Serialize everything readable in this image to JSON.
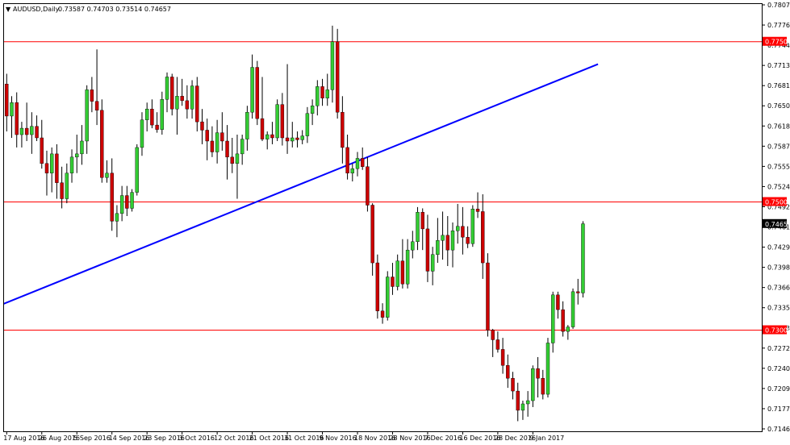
{
  "header": {
    "arrow": "▼",
    "symbol": "AUDUSD,Daily",
    "ohlc": "0.73587 0.74703 0.73514 0.74657"
  },
  "colors": {
    "background": "#ffffff",
    "frame": "#000000",
    "bull": "#33cc33",
    "bear": "#cc0000",
    "wick": "#000000",
    "hline": "#ff0000",
    "trendline": "#0000ff",
    "price_tag_bg": "#ff0000",
    "price_tag_text": "#ffffff",
    "current_tag_bg": "#000000",
    "current_tag_text": "#ffffff"
  },
  "chart_data": {
    "type": "candlestick",
    "symbol": "AUDUSD",
    "timeframe": "Daily",
    "ylim": [
      0.7146,
      0.78075
    ],
    "y_ticks": [
      "0.78075",
      "0.77760",
      "0.77445",
      "0.77130",
      "0.76815",
      "0.76500",
      "0.76185",
      "0.75870",
      "0.75555",
      "0.75240",
      "0.74925",
      "0.74610",
      "0.74295",
      "0.73980",
      "0.73665",
      "0.73350",
      "0.73035",
      "0.72720",
      "0.72405",
      "0.72090",
      "0.71775",
      "0.71460"
    ],
    "x_labels": [
      {
        "label": "17 Aug 2016",
        "index": 0
      },
      {
        "label": "26 Aug 2016",
        "index": 7
      },
      {
        "label": "5 Sep 2016",
        "index": 14
      },
      {
        "label": "14 Sep 2016",
        "index": 21
      },
      {
        "label": "23 Sep 2016",
        "index": 28
      },
      {
        "label": "3 Oct 2016",
        "index": 35
      },
      {
        "label": "12 Oct 2016",
        "index": 42
      },
      {
        "label": "21 Oct 2016",
        "index": 49
      },
      {
        "label": "31 Oct 2016",
        "index": 56
      },
      {
        "label": "9 Nov 2016",
        "index": 63
      },
      {
        "label": "18 Nov 2016",
        "index": 70
      },
      {
        "label": "28 Nov 2016",
        "index": 77
      },
      {
        "label": "7 Dec 2016",
        "index": 84
      },
      {
        "label": "16 Dec 2016",
        "index": 91
      },
      {
        "label": "28 Dec 2016",
        "index": 98
      },
      {
        "label": "9 Jan 2017",
        "index": 105
      }
    ],
    "candles": [
      [
        0.7684,
        0.77,
        0.761,
        0.7634
      ],
      [
        0.7634,
        0.7665,
        0.76,
        0.7655
      ],
      [
        0.7655,
        0.7671,
        0.7585,
        0.7605
      ],
      [
        0.7605,
        0.7625,
        0.7585,
        0.7615
      ],
      [
        0.7615,
        0.7655,
        0.7595,
        0.7605
      ],
      [
        0.7605,
        0.764,
        0.7575,
        0.7618
      ],
      [
        0.7618,
        0.7635,
        0.7595,
        0.76
      ],
      [
        0.76,
        0.7628,
        0.7552,
        0.756
      ],
      [
        0.756,
        0.758,
        0.751,
        0.7545
      ],
      [
        0.7545,
        0.7585,
        0.7515,
        0.7575
      ],
      [
        0.7575,
        0.759,
        0.7505,
        0.753
      ],
      [
        0.753,
        0.7555,
        0.749,
        0.7505
      ],
      [
        0.7505,
        0.756,
        0.7498,
        0.7545
      ],
      [
        0.7545,
        0.7582,
        0.753,
        0.757
      ],
      [
        0.757,
        0.7605,
        0.7545,
        0.7575
      ],
      [
        0.7575,
        0.762,
        0.7558,
        0.7595
      ],
      [
        0.7595,
        0.7682,
        0.7575,
        0.7675
      ],
      [
        0.7675,
        0.7695,
        0.764,
        0.7657
      ],
      [
        0.7657,
        0.7738,
        0.762,
        0.7643
      ],
      [
        0.7643,
        0.766,
        0.753,
        0.7538
      ],
      [
        0.7538,
        0.7565,
        0.753,
        0.7545
      ],
      [
        0.7545,
        0.7568,
        0.7455,
        0.747
      ],
      [
        0.747,
        0.7495,
        0.7445,
        0.7482
      ],
      [
        0.7482,
        0.7525,
        0.747,
        0.751
      ],
      [
        0.751,
        0.7525,
        0.7478,
        0.749
      ],
      [
        0.749,
        0.752,
        0.7485,
        0.7515
      ],
      [
        0.7515,
        0.759,
        0.751,
        0.7585
      ],
      [
        0.7585,
        0.764,
        0.7572,
        0.7628
      ],
      [
        0.7628,
        0.7655,
        0.761,
        0.7645
      ],
      [
        0.7645,
        0.766,
        0.7615,
        0.762
      ],
      [
        0.762,
        0.764,
        0.7608,
        0.7613
      ],
      [
        0.7613,
        0.7672,
        0.7605,
        0.766
      ],
      [
        0.766,
        0.7702,
        0.764,
        0.7695
      ],
      [
        0.7695,
        0.77,
        0.7635,
        0.7645
      ],
      [
        0.7645,
        0.7695,
        0.7605,
        0.7665
      ],
      [
        0.7665,
        0.7692,
        0.765,
        0.7658
      ],
      [
        0.7658,
        0.7682,
        0.763,
        0.7645
      ],
      [
        0.7645,
        0.769,
        0.763,
        0.7681
      ],
      [
        0.7681,
        0.7695,
        0.761,
        0.7625
      ],
      [
        0.7625,
        0.7645,
        0.759,
        0.7612
      ],
      [
        0.7612,
        0.763,
        0.7565,
        0.7595
      ],
      [
        0.7595,
        0.7618,
        0.757,
        0.7578
      ],
      [
        0.7578,
        0.7628,
        0.756,
        0.7608
      ],
      [
        0.7608,
        0.764,
        0.758,
        0.7595
      ],
      [
        0.7595,
        0.762,
        0.7535,
        0.757
      ],
      [
        0.757,
        0.76,
        0.7545,
        0.756
      ],
      [
        0.756,
        0.7605,
        0.7505,
        0.7575
      ],
      [
        0.7575,
        0.7605,
        0.7558,
        0.7598
      ],
      [
        0.7598,
        0.765,
        0.758,
        0.764
      ],
      [
        0.764,
        0.773,
        0.763,
        0.771
      ],
      [
        0.771,
        0.772,
        0.762,
        0.763
      ],
      [
        0.763,
        0.7695,
        0.7595,
        0.7598
      ],
      [
        0.7598,
        0.761,
        0.7582,
        0.7605
      ],
      [
        0.7605,
        0.7625,
        0.759,
        0.76
      ],
      [
        0.76,
        0.766,
        0.7595,
        0.7652
      ],
      [
        0.7652,
        0.767,
        0.7588,
        0.76
      ],
      [
        0.76,
        0.7715,
        0.7575,
        0.7595
      ],
      [
        0.7595,
        0.7625,
        0.7585,
        0.76
      ],
      [
        0.76,
        0.761,
        0.7585,
        0.7597
      ],
      [
        0.7597,
        0.7612,
        0.759,
        0.7603
      ],
      [
        0.7603,
        0.7648,
        0.7592,
        0.7638
      ],
      [
        0.7638,
        0.766,
        0.762,
        0.765
      ],
      [
        0.765,
        0.769,
        0.7635,
        0.768
      ],
      [
        0.768,
        0.7692,
        0.765,
        0.7662
      ],
      [
        0.7662,
        0.77,
        0.765,
        0.7675
      ],
      [
        0.7675,
        0.7775,
        0.7655,
        0.775
      ],
      [
        0.775,
        0.777,
        0.763,
        0.764
      ],
      [
        0.764,
        0.7665,
        0.756,
        0.7585
      ],
      [
        0.7585,
        0.7605,
        0.7535,
        0.7545
      ],
      [
        0.7545,
        0.756,
        0.7532,
        0.7552
      ],
      [
        0.7552,
        0.7578,
        0.754,
        0.7568
      ],
      [
        0.7568,
        0.7585,
        0.755,
        0.7555
      ],
      [
        0.7555,
        0.757,
        0.7485,
        0.7495
      ],
      [
        0.7495,
        0.7498,
        0.7385,
        0.7405
      ],
      [
        0.7405,
        0.7418,
        0.7318,
        0.733
      ],
      [
        0.733,
        0.7342,
        0.731,
        0.732
      ],
      [
        0.732,
        0.7392,
        0.7315,
        0.7383
      ],
      [
        0.7383,
        0.7405,
        0.7355,
        0.7368
      ],
      [
        0.7368,
        0.7418,
        0.7362,
        0.7408
      ],
      [
        0.7408,
        0.7442,
        0.7365,
        0.7372
      ],
      [
        0.7372,
        0.7442,
        0.7365,
        0.7425
      ],
      [
        0.7425,
        0.7455,
        0.7412,
        0.7438
      ],
      [
        0.7438,
        0.7492,
        0.7425,
        0.7484
      ],
      [
        0.7484,
        0.749,
        0.7425,
        0.7458
      ],
      [
        0.7458,
        0.748,
        0.7375,
        0.7392
      ],
      [
        0.7392,
        0.743,
        0.737,
        0.7418
      ],
      [
        0.7418,
        0.7475,
        0.7405,
        0.744
      ],
      [
        0.744,
        0.7485,
        0.741,
        0.7448
      ],
      [
        0.7448,
        0.7478,
        0.74,
        0.7425
      ],
      [
        0.7425,
        0.7468,
        0.7398,
        0.7455
      ],
      [
        0.7455,
        0.7497,
        0.7435,
        0.7462
      ],
      [
        0.7462,
        0.7492,
        0.7418,
        0.7445
      ],
      [
        0.7445,
        0.7462,
        0.7428,
        0.7435
      ],
      [
        0.7435,
        0.7495,
        0.743,
        0.7489
      ],
      [
        0.7489,
        0.7515,
        0.7475,
        0.7485
      ],
      [
        0.7485,
        0.7512,
        0.738,
        0.7405
      ],
      [
        0.7405,
        0.742,
        0.729,
        0.73
      ],
      [
        0.73,
        0.7302,
        0.7258,
        0.7285
      ],
      [
        0.7285,
        0.7298,
        0.7265,
        0.727
      ],
      [
        0.727,
        0.7288,
        0.7232,
        0.7245
      ],
      [
        0.7245,
        0.7262,
        0.721,
        0.7225
      ],
      [
        0.7225,
        0.7235,
        0.7192,
        0.7205
      ],
      [
        0.7205,
        0.7218,
        0.7158,
        0.7175
      ],
      [
        0.7175,
        0.719,
        0.716,
        0.7185
      ],
      [
        0.7185,
        0.7205,
        0.7165,
        0.719
      ],
      [
        0.719,
        0.7245,
        0.718,
        0.724
      ],
      [
        0.724,
        0.7258,
        0.7195,
        0.7225
      ],
      [
        0.7225,
        0.7238,
        0.7192,
        0.72
      ],
      [
        0.72,
        0.7288,
        0.7195,
        0.728
      ],
      [
        0.728,
        0.736,
        0.7265,
        0.7355
      ],
      [
        0.7355,
        0.736,
        0.7318,
        0.7332
      ],
      [
        0.7332,
        0.7345,
        0.729,
        0.7298
      ],
      [
        0.7298,
        0.7308,
        0.7285,
        0.7305
      ],
      [
        0.7305,
        0.7365,
        0.7302,
        0.736
      ],
      [
        0.736,
        0.738,
        0.734,
        0.7358
      ],
      [
        0.7358,
        0.747,
        0.7351,
        0.7466
      ]
    ],
    "horizontal_lines": [
      0.775,
      0.75,
      0.73
    ],
    "price_tags": [
      "0.77500",
      "0.75000",
      "0.73000"
    ],
    "current_price": "0.74657",
    "trendline": {
      "start": [
        0,
        0.7341
      ],
      "end": [
        118,
        0.7715
      ]
    }
  }
}
